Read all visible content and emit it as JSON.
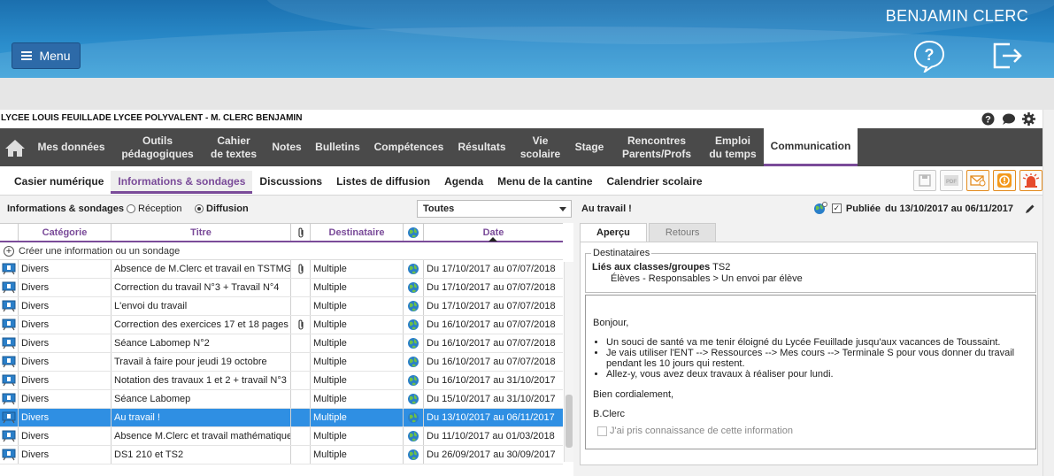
{
  "header": {
    "menu_label": "Menu",
    "user_name": "BENJAMIN CLERC"
  },
  "school": {
    "title": "LYCEE LOUIS FEUILLADE LYCEE POLYVALENT - M. CLERC BENJAMIN"
  },
  "main_nav": [
    {
      "label": "Mes données"
    },
    {
      "label": "Outils\npédagogiques"
    },
    {
      "label": "Cahier\nde textes"
    },
    {
      "label": "Notes"
    },
    {
      "label": "Bulletins"
    },
    {
      "label": "Compétences"
    },
    {
      "label": "Résultats"
    },
    {
      "label": "Vie\nscolaire"
    },
    {
      "label": "Stage"
    },
    {
      "label": "Rencontres\nParents/Profs"
    },
    {
      "label": "Emploi\ndu temps"
    },
    {
      "label": "Communication",
      "active": true
    }
  ],
  "sub_nav": [
    {
      "label": "Casier numérique"
    },
    {
      "label": "Informations & sondages",
      "active": true
    },
    {
      "label": "Discussions"
    },
    {
      "label": "Listes de diffusion"
    },
    {
      "label": "Agenda"
    },
    {
      "label": "Menu de la cantine"
    },
    {
      "label": "Calendrier scolaire"
    }
  ],
  "filter": {
    "label": "Informations & sondages",
    "radio_reception": "Réception",
    "radio_diffusion": "Diffusion",
    "selected_radio": "Diffusion",
    "select_value": "Toutes"
  },
  "grid": {
    "columns": {
      "category": "Catégorie",
      "title": "Titre",
      "recipient": "Destinataire",
      "date": "Date"
    },
    "create_label": "Créer une information ou un sondage",
    "rows": [
      {
        "category": "Divers",
        "title": "Absence de M.Clerc et travail en TSTMG",
        "attachment": true,
        "recipient": "Multiple",
        "date": "Du 17/10/2017 au 07/07/2018",
        "selected": false
      },
      {
        "category": "Divers",
        "title": "Correction du travail N°3 + Travail N°4",
        "attachment": false,
        "recipient": "Multiple",
        "date": "Du 17/10/2017 au 07/07/2018",
        "selected": false
      },
      {
        "category": "Divers",
        "title": "L'envoi du travail",
        "attachment": false,
        "recipient": "Multiple",
        "date": "Du 17/10/2017 au 07/07/2018",
        "selected": false
      },
      {
        "category": "Divers",
        "title": "Correction des exercices 17 et 18 pages",
        "attachment": true,
        "recipient": "Multiple",
        "date": "Du 16/10/2017 au 07/07/2018",
        "selected": false
      },
      {
        "category": "Divers",
        "title": "Séance Labomep N°2",
        "attachment": false,
        "recipient": "Multiple",
        "date": "Du 16/10/2017 au 07/07/2018",
        "selected": false
      },
      {
        "category": "Divers",
        "title": "Travail à faire pour jeudi 19 octobre",
        "attachment": false,
        "recipient": "Multiple",
        "date": "Du 16/10/2017 au 07/07/2018",
        "selected": false
      },
      {
        "category": "Divers",
        "title": "Notation  des travaux 1 et 2 + travail N°3",
        "attachment": false,
        "recipient": "Multiple",
        "date": "Du 16/10/2017 au 31/10/2017",
        "selected": false
      },
      {
        "category": "Divers",
        "title": "Séance Labomep",
        "attachment": false,
        "recipient": "Multiple",
        "date": "Du 15/10/2017 au 31/10/2017",
        "selected": false
      },
      {
        "category": "Divers",
        "title": "Au travail !",
        "attachment": false,
        "recipient": "Multiple",
        "date": "Du 13/10/2017 au 06/11/2017",
        "selected": true
      },
      {
        "category": "Divers",
        "title": "Absence M.Clerc et travail mathématique",
        "attachment": false,
        "recipient": "Multiple",
        "date": "Du 11/10/2017 au 01/03/2018",
        "selected": false
      },
      {
        "category": "Divers",
        "title": "DS1 210 et TS2",
        "attachment": false,
        "recipient": "Multiple",
        "date": "Du 26/09/2017 au 30/09/2017",
        "selected": false
      }
    ]
  },
  "detail": {
    "title": "Au travail !",
    "published_label": "Publiée",
    "published_range": "du 13/10/2017 au 06/11/2017",
    "tab_preview": "Aperçu",
    "tab_returns": "Retours",
    "recipients_legend": "Destinataires",
    "linked_label": "Liés aux classes/groupes",
    "linked_value": "TS2",
    "recipients_detail": "Élèves - Responsables > Un envoi par élève",
    "message": {
      "greeting": "Bonjour,",
      "bullets": [
        "Un souci de santé va me tenir éloigné du Lycée Feuillade jusqu'aux vacances de Toussaint.",
        "Je vais utiliser l'ENT --> Ressources --> Mes cours --> Terminale S pour vous donner du travail pendant les 10 jours qui restent.",
        "Allez-y, vous avez deux travaux à réaliser pour lundi."
      ],
      "closing": "Bien cordialement,",
      "signature": "B.Clerc"
    },
    "ack_label": "J'ai pris connaissance de cette information"
  },
  "colors": {
    "accent": "#7a4b99",
    "nav_bg": "#4a4a4a",
    "selection": "#2f8fe3",
    "banner": "#2a8ccb"
  }
}
